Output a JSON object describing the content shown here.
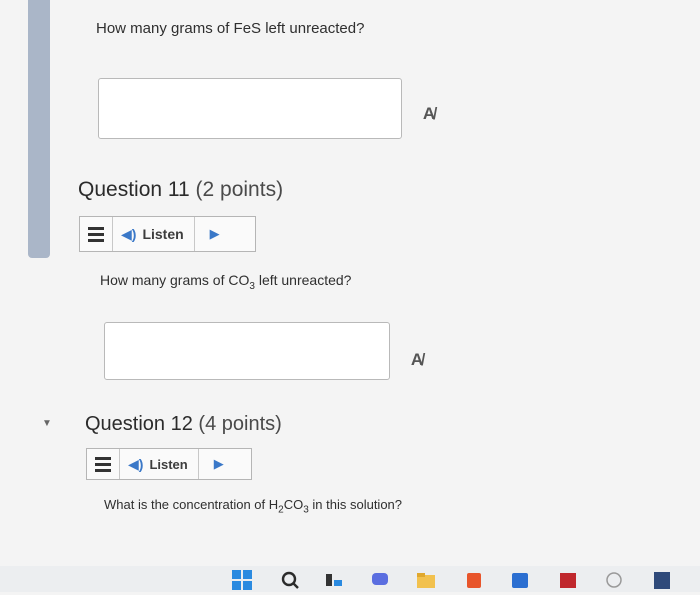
{
  "questions": [
    {
      "id": "q10",
      "text": "How many grams of FeS left unreacted?"
    },
    {
      "id": "q11",
      "label": "Question 11",
      "points": "(2 points)",
      "listen_label": "Listen",
      "text_before": "How many grams of CO",
      "text_sub": "3",
      "text_after": " left unreacted?"
    },
    {
      "id": "q12",
      "label": "Question 12",
      "points": "(4 points)",
      "listen_label": "Listen",
      "text_before": "What is the concentration of H",
      "text_sub1": "2",
      "text_mid": "CO",
      "text_sub2": "3",
      "text_after": " in this solution?"
    }
  ],
  "icons": {
    "spellcheck": "spellcheck-icon",
    "menu": "hamburger-menu-icon",
    "speaker": "speaker-icon",
    "play": "play-icon"
  },
  "colors": {
    "accent_blue": "#3a78c8",
    "sidebar": "#aab6c8",
    "windows_blue": "#2a8ae0"
  }
}
